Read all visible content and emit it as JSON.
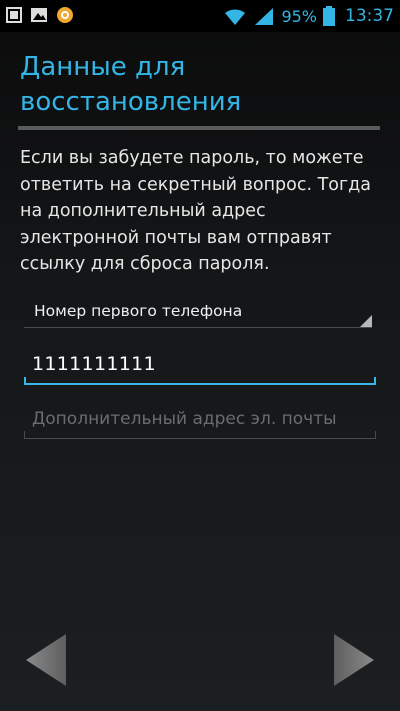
{
  "status_bar": {
    "left_icons": [
      "notification-square-icon",
      "image-icon",
      "app-badge-icon"
    ],
    "battery_percent": "95%",
    "time": "13:37",
    "accent_color": "#33b5e5"
  },
  "title": "Данные для восстановления",
  "description": "Если вы забудете пароль, то можете ответить на секретный вопрос. Тогда на дополнительный адрес электронной почты вам отправят ссылку для сброса пароля.",
  "recovery_method": {
    "selected_value": "Номер первого телефона"
  },
  "phone_input": {
    "value": "1111111111"
  },
  "email_input": {
    "placeholder": "Дополнительный адрес эл. почты",
    "value": ""
  },
  "navigation": {
    "prev_icon": "left-arrow-icon",
    "next_icon": "right-arrow-icon"
  }
}
